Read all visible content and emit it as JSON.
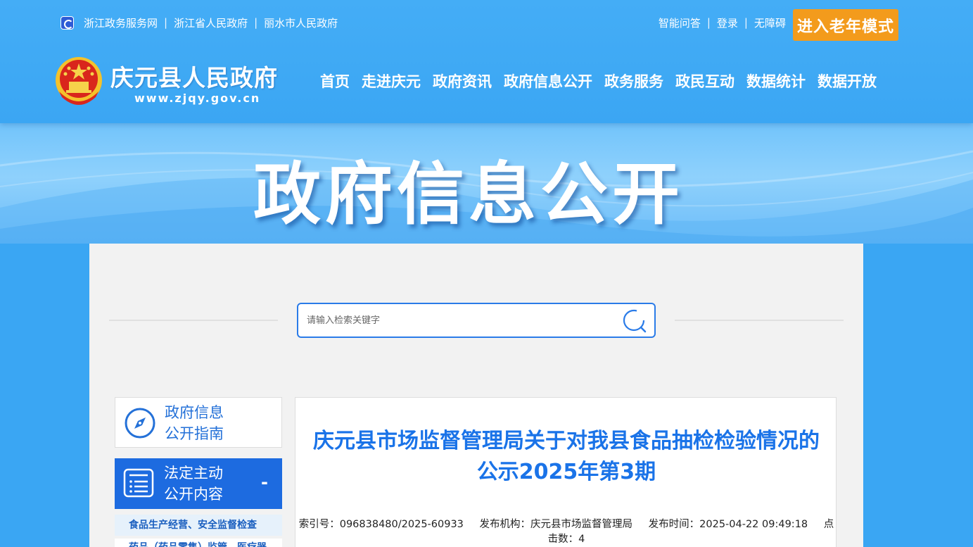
{
  "header": {
    "top_links": [
      "浙江政务服务网",
      "浙江省人民政府",
      "丽水市人民政府"
    ],
    "right_links": [
      "智能问答",
      "登录",
      "无障碍"
    ],
    "elder_mode_label": "进入老年模式",
    "site_title": "庆元县人民政府",
    "site_url": "www.zjqy.gov.cn",
    "nav": [
      "首页",
      "走进庆元",
      "政府资讯",
      "政府信息公开",
      "政务服务",
      "政民互动",
      "数据统计",
      "数据开放"
    ]
  },
  "banner": {
    "title": "政府信息公开"
  },
  "search": {
    "placeholder": "请输入检索关键字"
  },
  "sidebar": {
    "guide_line1": "政府信息",
    "guide_line2": "公开指南",
    "statutory_line1": "法定主动",
    "statutory_line2": "公开内容",
    "collapse_symbol": "-",
    "sub_items": [
      "食品生产经营、安全监督检查",
      "药品（药品零售）监管、医疗器"
    ]
  },
  "article": {
    "title": "庆元县市场监督管理局关于对我县食品抽检检验情况的公示2025年第3期",
    "index_label": "索引号：",
    "index_value": "096838480/2025-60933",
    "publisher_label": "发布机构：",
    "publisher_value": "庆元县市场监督管理局",
    "time_label": "发布时间：",
    "time_value": "2025-04-22 09:49:18",
    "clicks_label": "点击数：",
    "clicks_value": "4"
  },
  "colors": {
    "header_blue": "#3ba6f3",
    "accent_orange": "#f39b1c",
    "link_blue": "#1a73e8",
    "nav_active_blue": "#1d6be0"
  }
}
